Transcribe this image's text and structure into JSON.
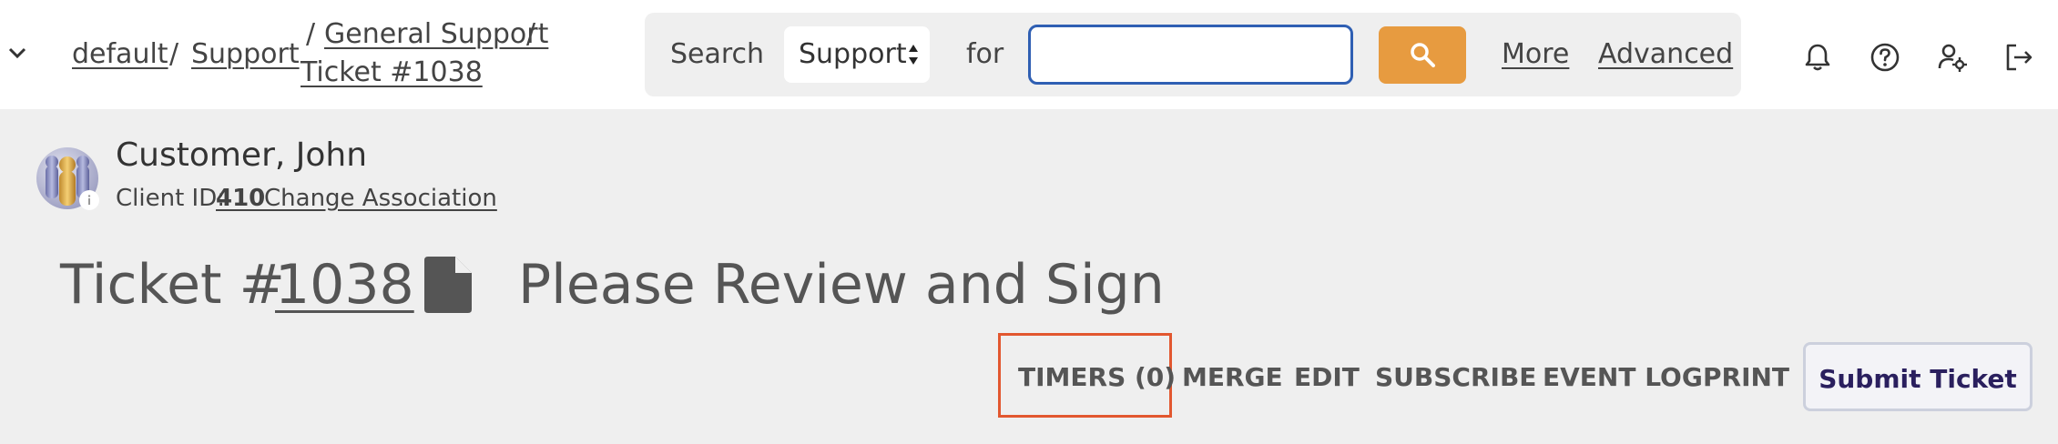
{
  "breadcrumb": {
    "items": [
      "default",
      "Support",
      "General Support",
      "Ticket #1038"
    ],
    "separator": "/"
  },
  "search": {
    "label": "Search",
    "scope": "Support",
    "for_label": "for",
    "value": "",
    "more": "More",
    "advanced": "Advanced"
  },
  "header_icons": [
    "bell-icon",
    "help-icon",
    "user-settings-icon",
    "logout-icon"
  ],
  "customer": {
    "name": "Customer, John",
    "client_id_label": "Client ID:",
    "client_id": "410",
    "change_association": "Change Association"
  },
  "ticket": {
    "prefix": "Ticket #",
    "number": "1038",
    "subject": "Please Review and Sign"
  },
  "actions": {
    "timers": "TIMERS (0)",
    "merge": "MERGE",
    "edit": "EDIT",
    "subscribe": "SUBSCRIBE",
    "event_log": "EVENT LOG",
    "print": "PRINT",
    "submit": "Submit Ticket"
  },
  "colors": {
    "accent_orange": "#e79b40",
    "highlight_red": "#e2572f",
    "input_border": "#2f5fb3",
    "submit_text": "#2a1f5e"
  }
}
